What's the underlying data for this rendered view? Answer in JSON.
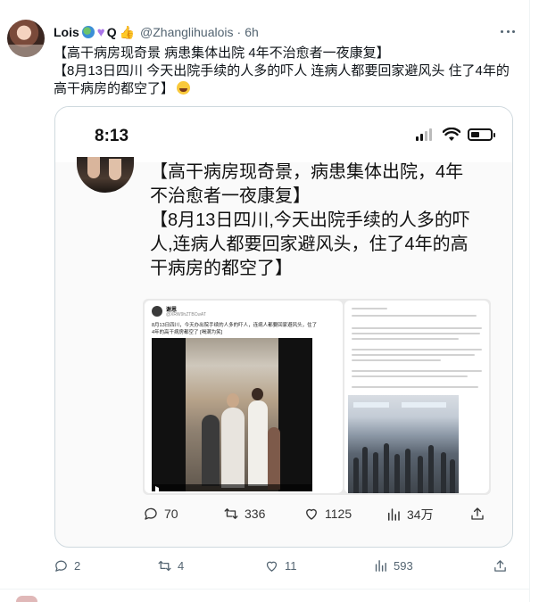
{
  "tweet": {
    "display_name": "Lois",
    "name_emojis": [
      "globe-icon",
      "purple-heart-icon",
      "thumbs-up-icon"
    ],
    "name_letter": "Q",
    "handle": "@Zhanglihualois",
    "separator": "·",
    "time": "6h",
    "text_line1": "【高干病房现奇景 病患集体出院 4年不治愈者一夜康复】",
    "text_line2": "【8月13日四川 今天出院手续的人多的吓人 连病人都要回家避风头 住了4年的",
    "text_line3": "高干病房的都空了】",
    "text_emoji": "laughing-tears-icon"
  },
  "embedded_screenshot": {
    "clock": "8:13",
    "text_lines": [
      "【高干病房现奇景，病患集体出院，4年",
      "不治愈者一夜康复】",
      "【8月13日四川,今天出院手续的人多的吓",
      "人,连病人都要回家避风头，住了4年的高",
      "干病房的都空了】"
    ],
    "inner_post": {
      "name": "谢恩",
      "handle": "@XRW9hZTBCwAT",
      "text_line1": "8月13日四川，今天办出院手续的人多的吓人，连病人都要回家避风头，住了",
      "text_line2": "4年的高干病房都空了 [喝满为笑]"
    },
    "actions": {
      "replies": "70",
      "retweets": "336",
      "likes": "1125",
      "views": "34万"
    }
  },
  "actions": {
    "replies": "2",
    "retweets": "4",
    "likes": "11",
    "views": "593"
  },
  "colors": {
    "text_primary": "#0f1419",
    "text_secondary": "#536471",
    "border": "#cfd9de"
  }
}
